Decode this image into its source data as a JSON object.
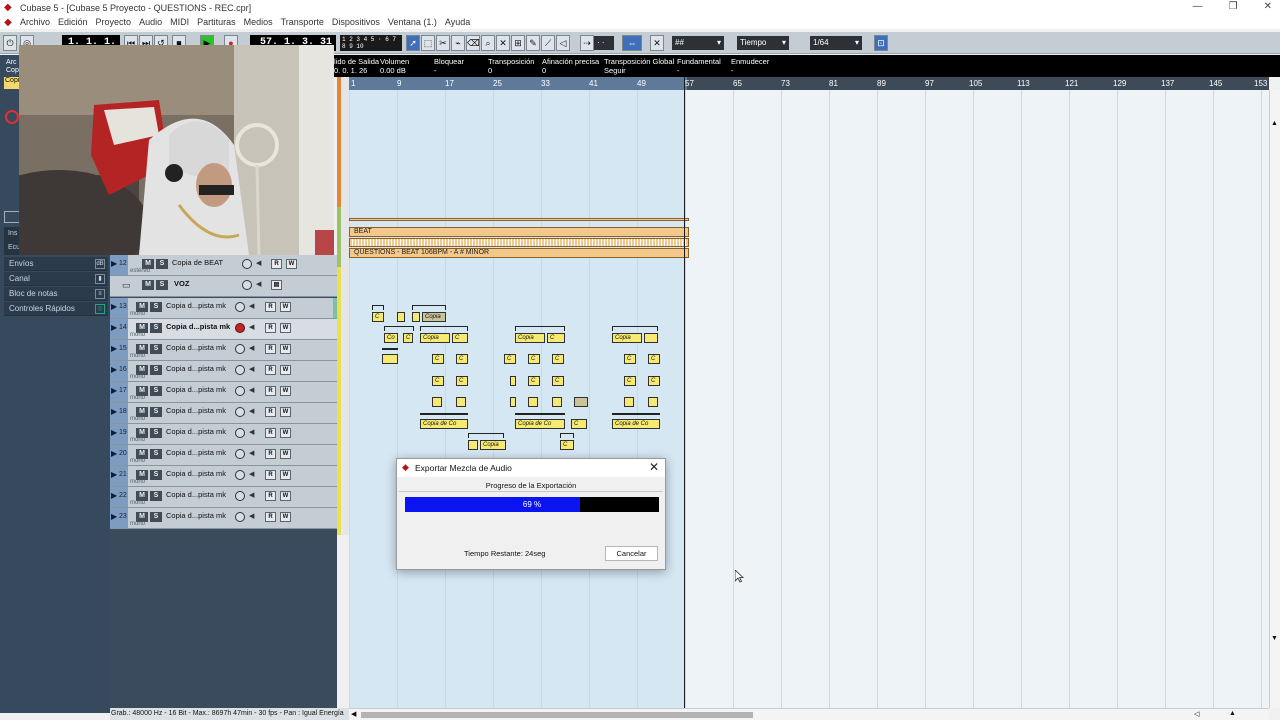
{
  "window": {
    "title": "Cubase 5 - [Cubase 5 Proyecto - QUESTIONS - REC.cpr]",
    "controls": [
      "—",
      "❐",
      "✕"
    ]
  },
  "menu": [
    "Archivo",
    "Edición",
    "Proyecto",
    "Audio",
    "MIDI",
    "Partituras",
    "Medios",
    "Transporte",
    "Dispositivos",
    "Ventana (1.)",
    "Ayuda"
  ],
  "toolbar": {
    "left_locator": "1. 1. 1.   0",
    "position": "57. 1. 3. 31",
    "snap_mode": "Tiempo",
    "quantize": "1/64",
    "snap_value": "· ·"
  },
  "infoline": [
    {
      "label": "lido de Salida",
      "value": "0. 0. 1. 26"
    },
    {
      "label": "Volumen",
      "value": "0.00 dB"
    },
    {
      "label": "Bloquear",
      "value": "-"
    },
    {
      "label": "Transposición",
      "value": "0"
    },
    {
      "label": "Afinación precisa",
      "value": "0"
    },
    {
      "label": "Transposición Global",
      "value": "Seguir"
    },
    {
      "label": "Fundamental",
      "value": "-"
    },
    {
      "label": "Enmudecer",
      "value": "-"
    }
  ],
  "inspector": {
    "left_labels": [
      "Arc",
      "Cop",
      "Copi"
    ],
    "side_labels": [
      "Ins",
      "Ecu"
    ],
    "panels": [
      "Envíos",
      "Canal",
      "Bloc de notas",
      "Controles Rápidos"
    ]
  },
  "ruler": {
    "marks": [
      "1",
      "9",
      "17",
      "25",
      "33",
      "41",
      "49",
      "57",
      "65",
      "73",
      "81",
      "89",
      "97",
      "105",
      "113",
      "121",
      "129",
      "137",
      "145",
      "153"
    ]
  },
  "tracks": [
    {
      "num": "12",
      "name": "Copia de BEAT",
      "sub": "estéreo",
      "type": "audio"
    },
    {
      "num": "",
      "name": "VOZ",
      "sub": "",
      "type": "folder"
    },
    {
      "num": "13",
      "name": "Copia d...pista mk",
      "sub": "mono",
      "type": "audio"
    },
    {
      "num": "14",
      "name": "Copia d...pista mk",
      "sub": "mono",
      "type": "audio",
      "selected": true
    },
    {
      "num": "15",
      "name": "Copia d...pista mk",
      "sub": "mono",
      "type": "audio"
    },
    {
      "num": "16",
      "name": "Copia d...pista mk",
      "sub": "mono",
      "type": "audio"
    },
    {
      "num": "17",
      "name": "Copia d...pista mk",
      "sub": "mono",
      "type": "audio"
    },
    {
      "num": "18",
      "name": "Copia d...pista mk",
      "sub": "mono",
      "type": "audio"
    },
    {
      "num": "19",
      "name": "Copia d...pista mk",
      "sub": "mono",
      "type": "audio"
    },
    {
      "num": "20",
      "name": "Copia d...pista mk",
      "sub": "mono",
      "type": "audio"
    },
    {
      "num": "21",
      "name": "Copia d...pista mk",
      "sub": "mono",
      "type": "audio"
    },
    {
      "num": "22",
      "name": "Copia d...pista mk",
      "sub": "mono",
      "type": "audio"
    },
    {
      "num": "23",
      "name": "Copia d...pista mk",
      "sub": "mono",
      "type": "audio"
    }
  ],
  "track_buttons": {
    "mute": "M",
    "solo": "S",
    "read": "R",
    "write": "W"
  },
  "parts": {
    "beat": "BEAT",
    "beat_copy": "QUESTIONS - BEAT 106BPM - A # MINOR",
    "clip": "Copia",
    "clip_short": "Co",
    "clip_long": "Copia de Co",
    "c": "C"
  },
  "colors": {
    "accent_blue": "#0a14f0",
    "part_orange": "#f3c98b",
    "event_yellow": "#f7ea72",
    "record_red": "#c42424"
  },
  "statusbar": "Grab.: 48000 Hz - 16 Bit - Max.: 8697h 47min - 30 fps - Pan : Igual Energía",
  "dialog": {
    "title": "Exportar Mezcla de Audio",
    "subtitle": "Progreso de la Exportación",
    "progress": 0.69,
    "progress_label": "69 %",
    "remaining": "Tiempo Restante: 24seg",
    "cancel": "Cancelar"
  }
}
